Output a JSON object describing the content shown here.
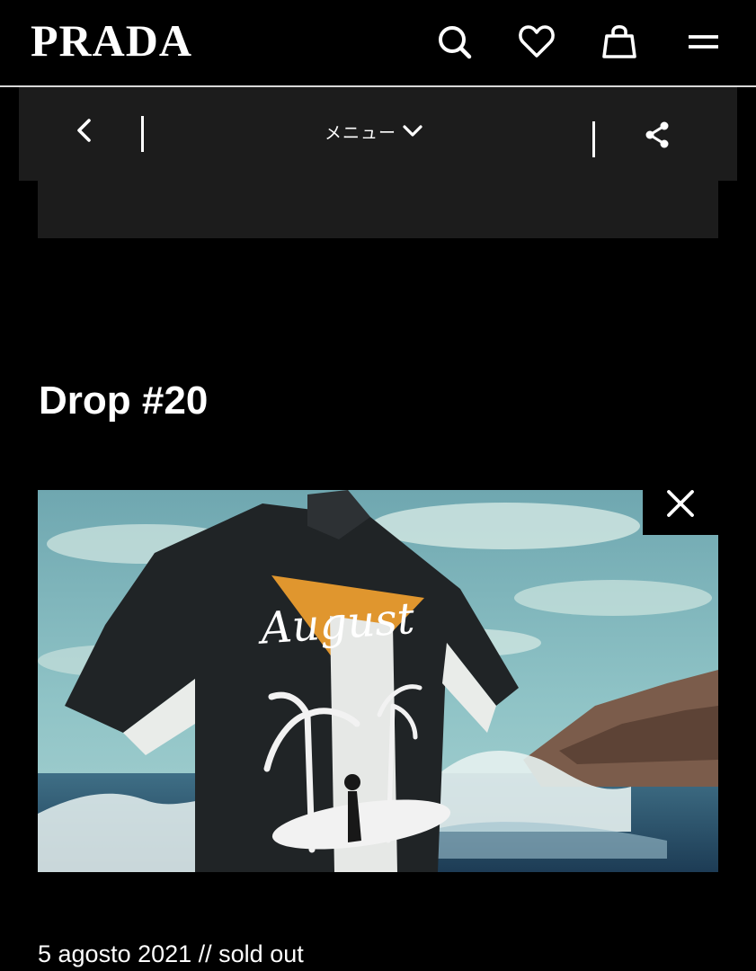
{
  "header": {
    "logo_text": "PRADA",
    "icons": [
      "search-icon",
      "heart-icon",
      "shopping-bag-icon",
      "hamburger-menu-icon"
    ]
  },
  "subnav": {
    "menu_label": "メニュー",
    "icons": [
      "chevron-left-icon",
      "chevron-down-icon",
      "share-icon"
    ]
  },
  "main": {
    "title": "Drop #20",
    "media": {
      "shirt_text": "August",
      "close_icon": "close-icon"
    },
    "caption": "5 agosto 2021 // sold out"
  },
  "colors": {
    "background": "#000000",
    "panel": "#1c1c1c",
    "text": "#ffffff",
    "divider": "#d8d8d8",
    "accent_orange": "#e0962e"
  }
}
